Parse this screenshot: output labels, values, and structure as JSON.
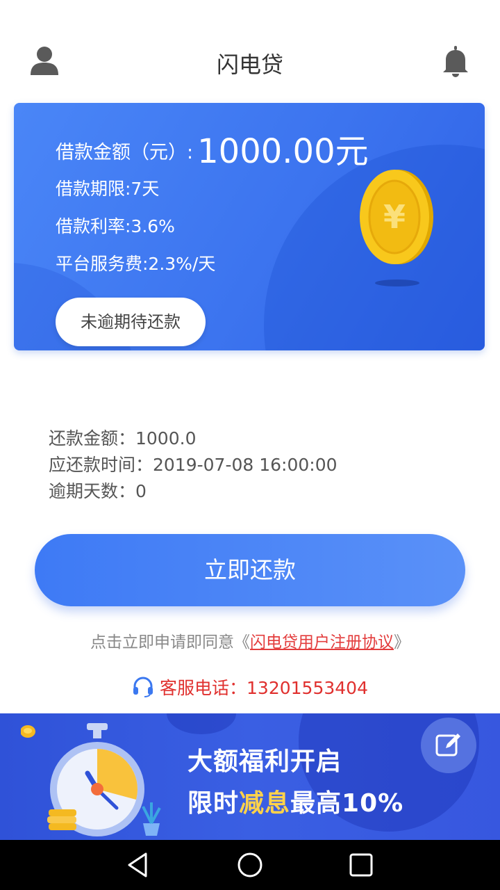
{
  "header": {
    "title": "闪电贷",
    "left_icon": "user-icon",
    "right_icon": "bell-icon"
  },
  "loan_card": {
    "amount_label": "借款金额（元）:",
    "amount_value": "1000.00元",
    "term": "借款期限:7天",
    "rate": "借款利率:3.6%",
    "service_fee": "平台服务费:2.3%/天",
    "status_button": "未逾期待还款",
    "coin_symbol": "¥"
  },
  "repayment": {
    "amount": "还款金额：1000.0",
    "due_time": "应还款时间：2019-07-08 16:00:00",
    "overdue_days": "逾期天数：0"
  },
  "repay_button": "立即还款",
  "agreement": {
    "prefix": "点击立即申请即同意《",
    "link": "闪电贷用户注册协议",
    "suffix": "》"
  },
  "customer_service": {
    "text": "客服电话：13201553404",
    "icon": "headset-icon"
  },
  "banner": {
    "line1": "大额福利开启",
    "line2_prefix": "限时",
    "line2_highlight": "减息",
    "line2_suffix": "最高10%",
    "edit_icon": "edit-icon"
  },
  "colors": {
    "primary": "#3e7af5",
    "link_red": "#e33d3d",
    "service_red": "#e0302e",
    "coin_gold": "#f5c518"
  }
}
